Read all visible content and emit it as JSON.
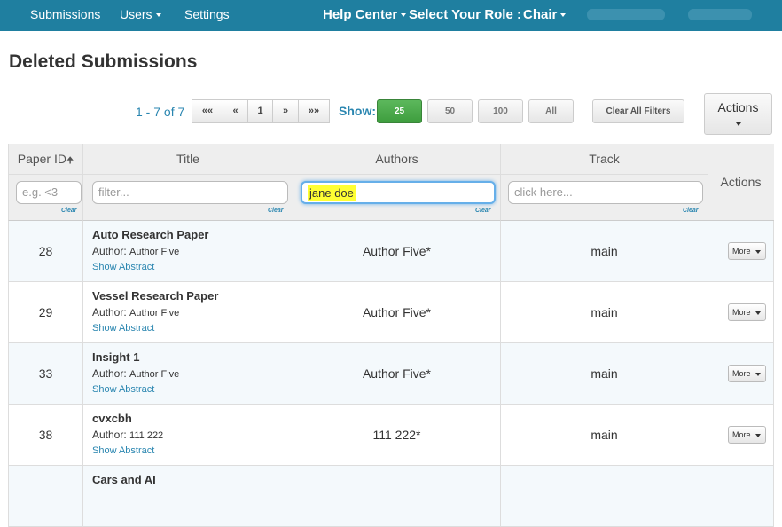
{
  "nav": {
    "submissions": "Submissions",
    "users": "Users",
    "settings": "Settings",
    "help_center": "Help Center",
    "role_label": "Select Your Role :",
    "role_value": "Chair"
  },
  "page_title": "Deleted Submissions",
  "pagination": {
    "range": "1 - 7 of 7",
    "first": "««",
    "prev": "«",
    "current": "1",
    "next": "»",
    "last": "»»"
  },
  "show": {
    "label": "Show:",
    "options": [
      "25",
      "50",
      "100",
      "All"
    ],
    "selected": "25"
  },
  "clear_all_filters": "Clear All Filters",
  "actions_button": "Actions",
  "table": {
    "headers": {
      "paper_id": "Paper ID",
      "paper_id_sort": "🠉",
      "title": "Title",
      "authors": "Authors",
      "track": "Track",
      "actions": "Actions"
    },
    "filters": {
      "paper_id_placeholder": "e.g. <3",
      "title_placeholder": "filter...",
      "authors_value": "jane doe",
      "track_placeholder": "click here...",
      "clear": "Clear"
    },
    "author_prefix": "Author:",
    "show_abstract": "Show Abstract",
    "more": "More",
    "rows": [
      {
        "id": "28",
        "title": "Auto Research Paper",
        "author": "Author Five",
        "authors": "Author Five*",
        "track": "main"
      },
      {
        "id": "29",
        "title": "Vessel Research Paper",
        "author": "Author Five",
        "authors": "Author Five*",
        "track": "main"
      },
      {
        "id": "33",
        "title": "Insight 1",
        "author": "Author Five",
        "authors": "Author Five*",
        "track": "main"
      },
      {
        "id": "38",
        "title": "cvxcbh",
        "author": "111 222",
        "authors": "111 222*",
        "track": "main"
      },
      {
        "title": "Cars and AI"
      }
    ]
  }
}
